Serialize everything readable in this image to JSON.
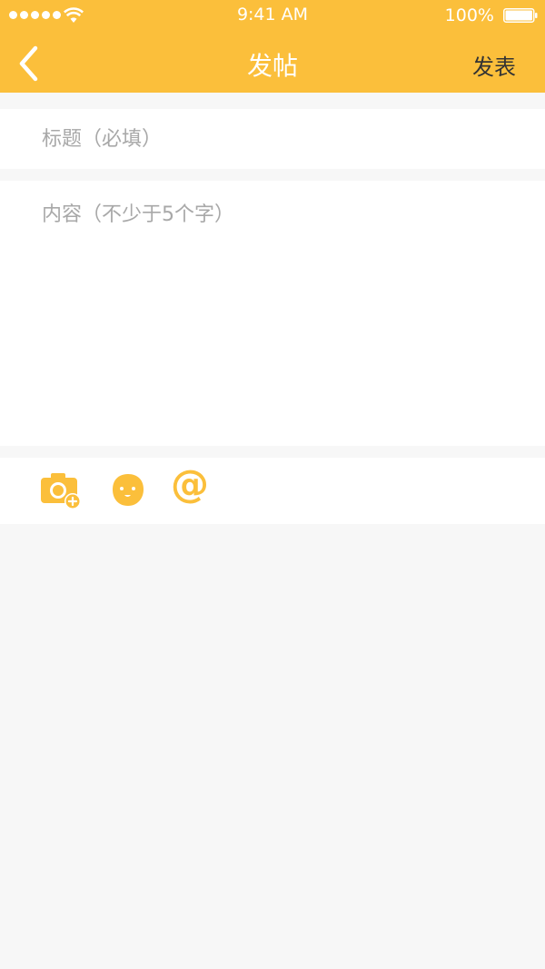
{
  "status_bar": {
    "time": "9:41 AM",
    "battery_percent": "100%",
    "battery_level": 1.0,
    "icons": [
      "signal-dots-icon",
      "wifi-icon",
      "battery-icon"
    ]
  },
  "nav": {
    "title": "发帖",
    "back_icon": "chevron-left-icon",
    "publish_label": "发表"
  },
  "form": {
    "title_placeholder": "标题（必填）",
    "title_value": "",
    "content_placeholder": "内容（不少于5个字）",
    "content_value": ""
  },
  "toolbar": {
    "items": [
      {
        "icon": "camera-add-icon"
      },
      {
        "icon": "emoji-icon"
      },
      {
        "icon": "at-mention-icon",
        "glyph": "@"
      }
    ]
  },
  "colors": {
    "accent": "#fbbf3b",
    "background": "#f7f7f7",
    "placeholder": "#a8a8a8",
    "publish_text": "#333333"
  }
}
